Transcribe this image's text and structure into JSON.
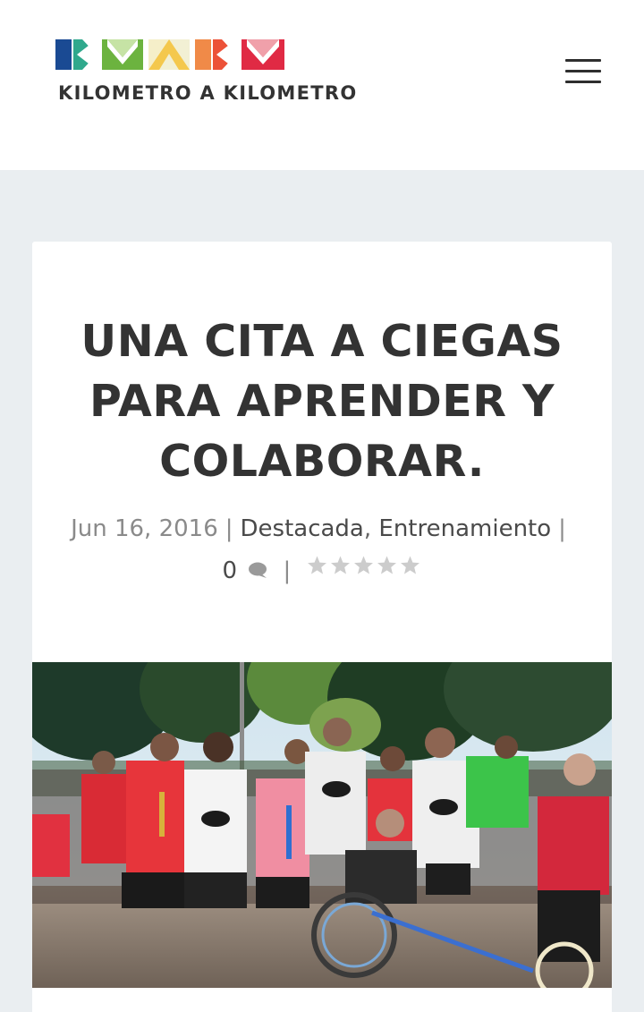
{
  "header": {
    "logo_text": "KILOMETRO A KILOMETRO",
    "logo_letters": [
      "K",
      "M",
      "A",
      "K",
      "M"
    ],
    "logo_colors": [
      "#1a4a93",
      "#2fa88c",
      "#6cb33f",
      "#f2f0d4",
      "#f4c84d",
      "#f08a48",
      "#ec5238",
      "#e02a44"
    ],
    "menu_icon": "hamburger-icon"
  },
  "post": {
    "title_lines": [
      "UNA CITA A CIEGAS",
      "PARA APRENDER Y",
      "COLABORAR."
    ],
    "date": "Jun 16, 2016",
    "separator": "|",
    "categories": [
      "Destacada",
      "Entrenamiento"
    ],
    "category_separator": ",",
    "comment_count": "0",
    "comment_icon": "comment-bubble-icon",
    "rating": {
      "value": 0,
      "max": 5,
      "icon": "star-icon",
      "empty_color": "#cccccc"
    },
    "image_alt": "Grupo de corredores LYNCES posando con trofeos en una carrera"
  }
}
